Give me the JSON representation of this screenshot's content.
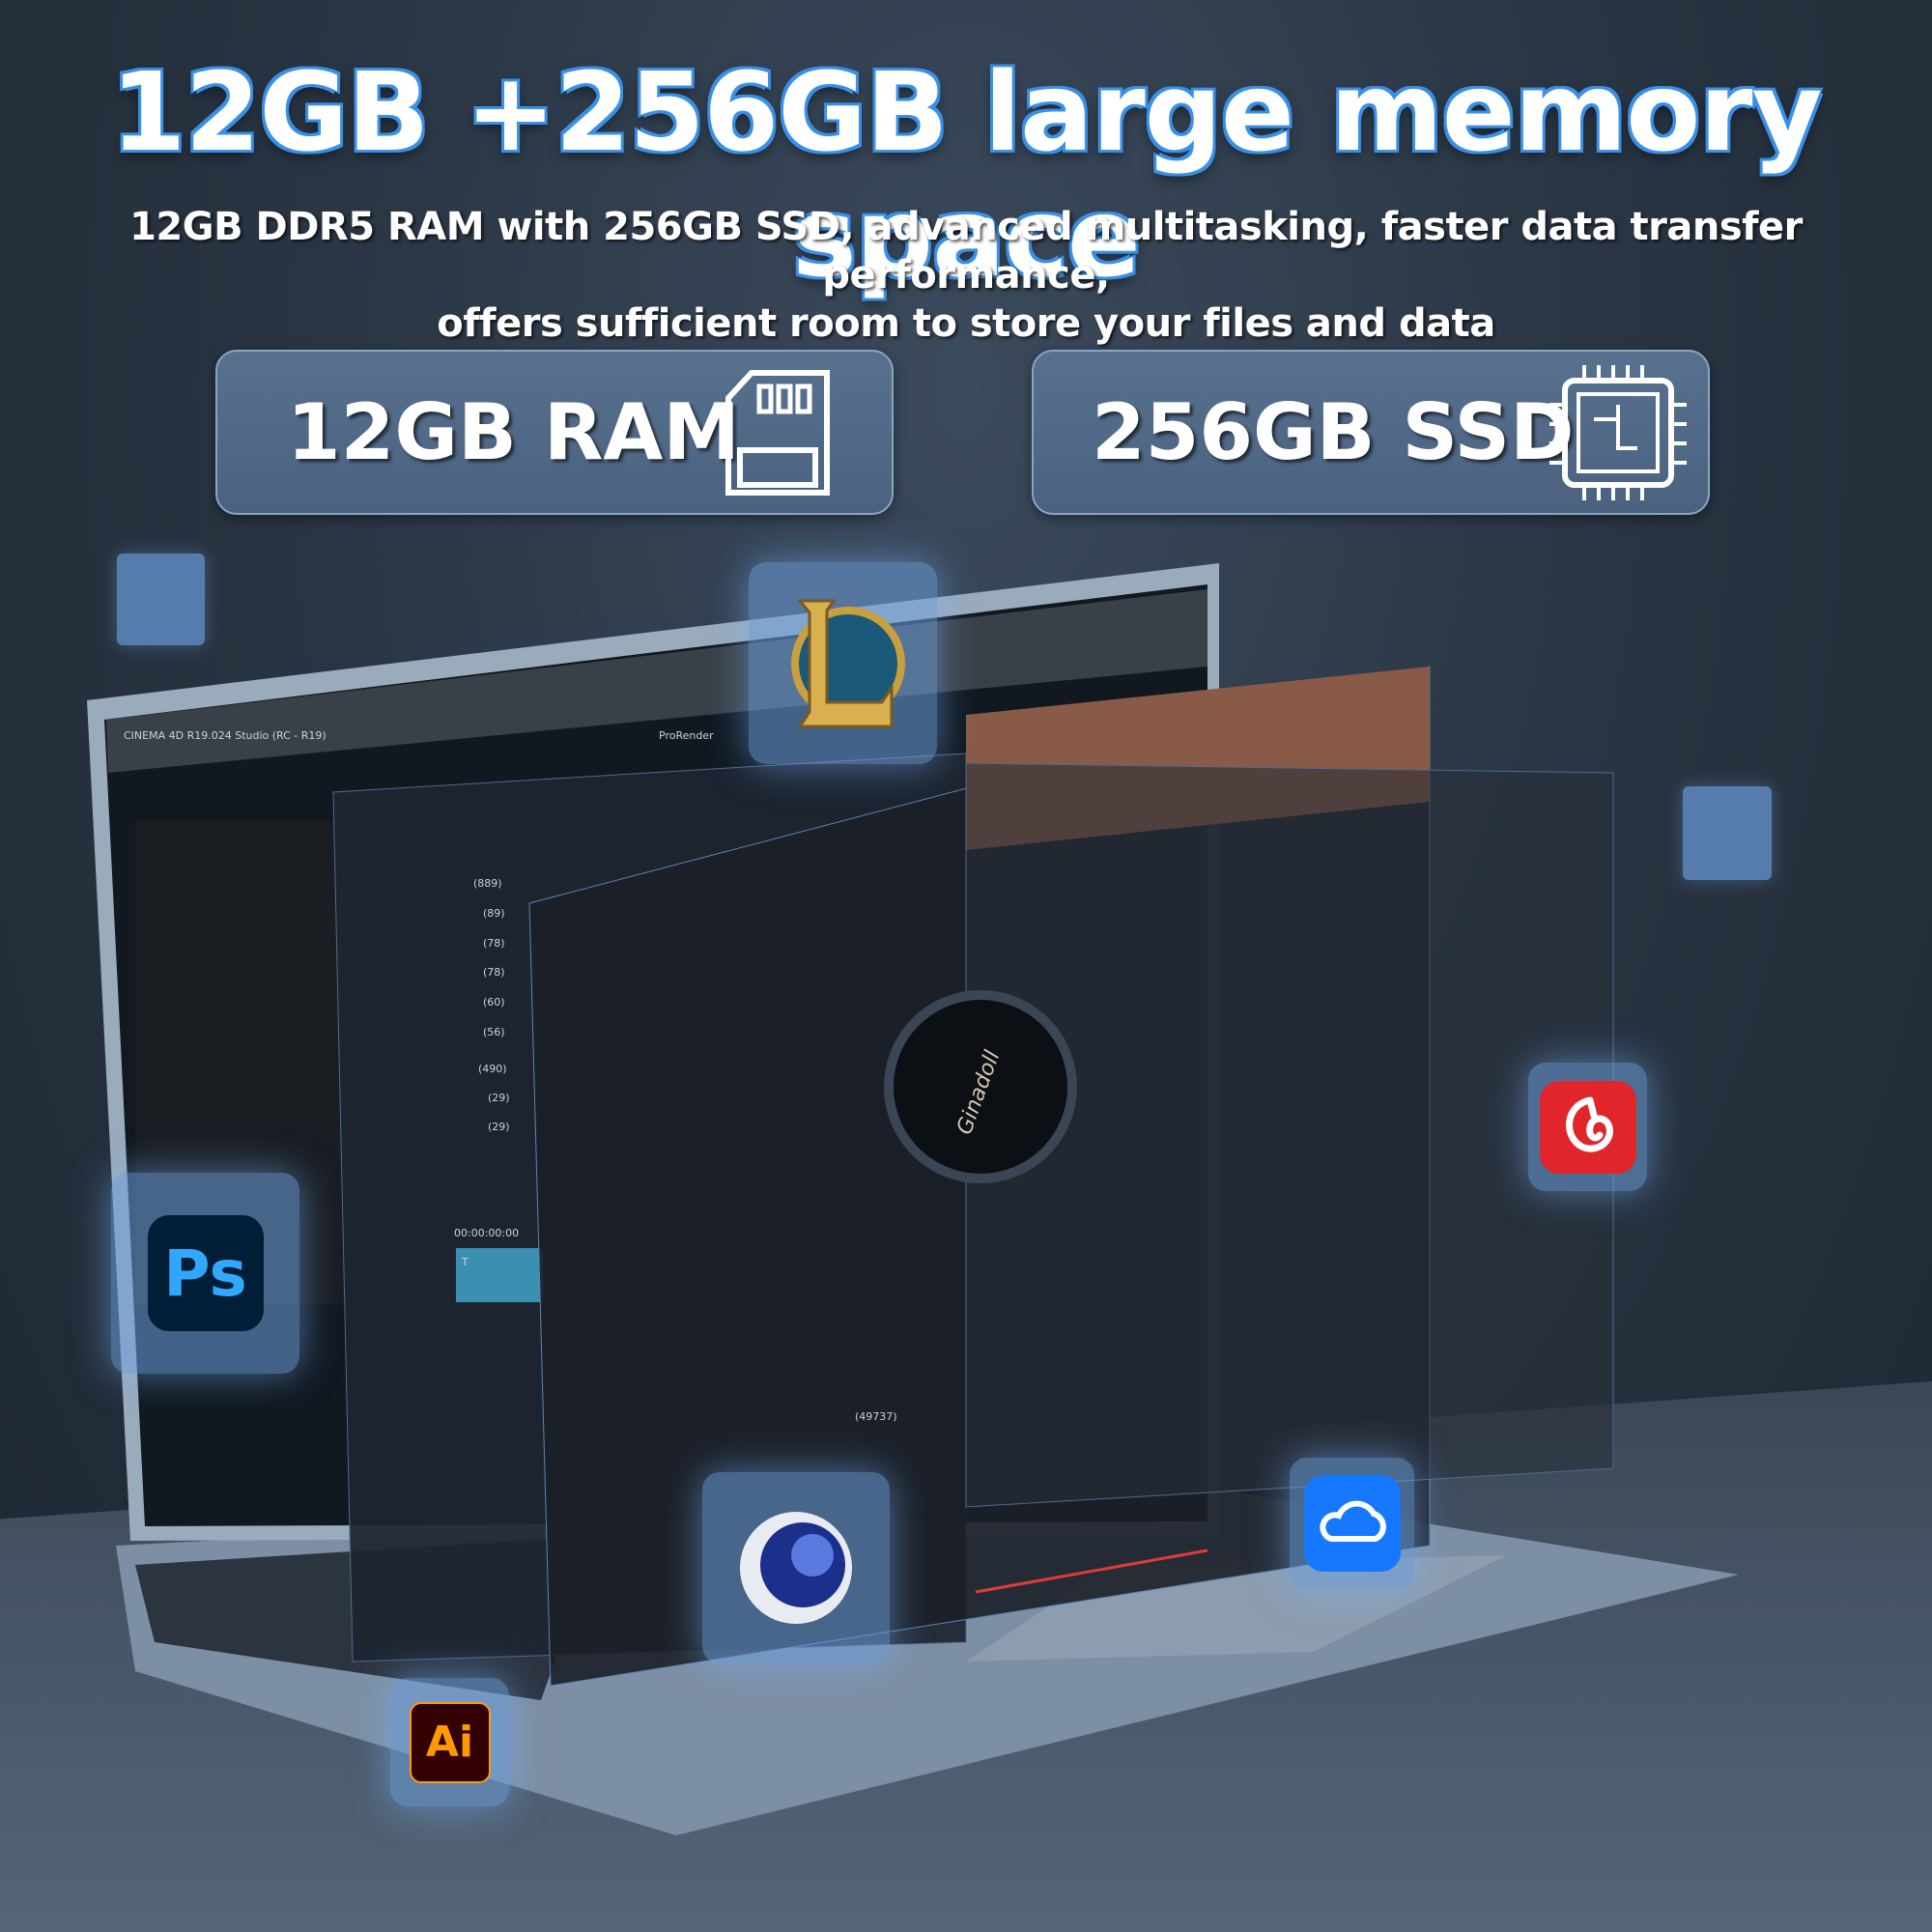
{
  "headline": "12GB +256GB large memory space",
  "description": {
    "line1": "12GB DDR5 RAM with 256GB SSD, advanced multitasking, faster data transfer performance,",
    "line2": "offers sufficient room to store your files and data"
  },
  "specs": [
    {
      "label": "12GB RAM",
      "icon": "memory-card-icon"
    },
    {
      "label": "256GB SSD",
      "icon": "chip-icon"
    }
  ],
  "apps": [
    {
      "name": "League of Legends",
      "icon": "league-of-legends-icon"
    },
    {
      "name": "Photoshop",
      "icon_text": "Ps",
      "color": "#31a8ff"
    },
    {
      "name": "NetEase Cloud Music",
      "icon": "netease-music-icon",
      "color": "#e0262b"
    },
    {
      "name": "Cinema 4D",
      "icon": "cinema4d-icon"
    },
    {
      "name": "Cloud storage",
      "icon": "cloud-icon",
      "color": "#1677ff"
    },
    {
      "name": "Illustrator",
      "icon_text": "Ai",
      "color": "#ff9a00"
    }
  ],
  "screen": {
    "c4d_title": "CINEMA 4D R19.024 Studio (RC - R19)",
    "renderer": "ProRender",
    "editor_counts": [
      "(889)",
      "(89)",
      "(78)",
      "(78)",
      "(60)",
      "(56)",
      "(490)",
      "(29)",
      "(29)"
    ],
    "timecode": "00:00:00:00",
    "track_label": "T",
    "comments": "(49737)",
    "cover_text": "Ginadoll"
  },
  "colors": {
    "accent": "#3a8fe6",
    "panel": "#4a6280"
  }
}
